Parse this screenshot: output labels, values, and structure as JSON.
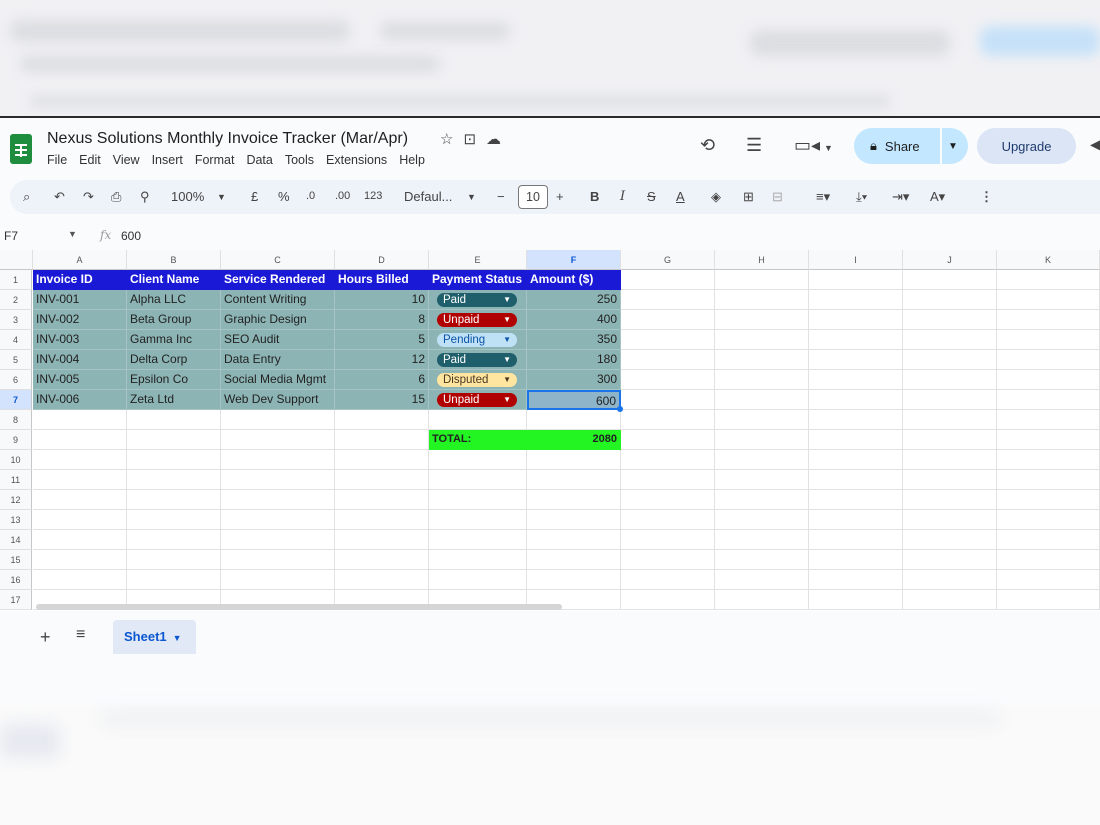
{
  "doc": {
    "title": "Nexus Solutions Monthly Invoice Tracker (Mar/Apr)",
    "menu": [
      "File",
      "Edit",
      "View",
      "Insert",
      "Format",
      "Data",
      "Tools",
      "Extensions",
      "Help"
    ]
  },
  "header": {
    "share_label": "Share",
    "upgrade_label": "Upgrade"
  },
  "toolbar": {
    "zoom": "100%",
    "currency": "£",
    "percent": "%",
    "dec_less": ".0",
    "dec_more": ".00",
    "number_format": "123",
    "font": "Defaul...",
    "font_size": "10",
    "minus": "−",
    "plus": "+",
    "bold": "B",
    "italic": "I"
  },
  "formula_bar": {
    "name_box": "F7",
    "fx": "fx",
    "value": "600"
  },
  "columns": [
    "A",
    "B",
    "C",
    "D",
    "E",
    "F",
    "G",
    "H",
    "I",
    "J",
    "K"
  ],
  "rows": [
    "1",
    "2",
    "3",
    "4",
    "5",
    "6",
    "7",
    "8",
    "9",
    "10",
    "11",
    "12",
    "13",
    "14",
    "15",
    "16",
    "17"
  ],
  "table": {
    "headers": [
      "Invoice ID",
      "Client Name",
      "Service Rendered",
      "Hours Billed",
      "Payment Status",
      "Amount ($)"
    ],
    "rows": [
      {
        "id": "INV-001",
        "client": "Alpha LLC",
        "service": "Content Writing",
        "hours": "10",
        "status": "Paid",
        "amount": "250"
      },
      {
        "id": "INV-002",
        "client": "Beta Group",
        "service": "Graphic Design",
        "hours": "8",
        "status": "Unpaid",
        "amount": "400"
      },
      {
        "id": "INV-003",
        "client": "Gamma Inc",
        "service": "SEO Audit",
        "hours": "5",
        "status": "Pending",
        "amount": "350"
      },
      {
        "id": "INV-004",
        "client": "Delta Corp",
        "service": "Data Entry",
        "hours": "12",
        "status": "Paid",
        "amount": "180"
      },
      {
        "id": "INV-005",
        "client": "Epsilon Co",
        "service": "Social Media Mgmt",
        "hours": "6",
        "status": "Disputed",
        "amount": "300"
      },
      {
        "id": "INV-006",
        "client": "Zeta Ltd",
        "service": "Web Dev Support",
        "hours": "15",
        "status": "Unpaid",
        "amount": "600"
      }
    ],
    "total_label": "TOTAL:",
    "total_value": "2080"
  },
  "status_colors": {
    "Paid": {
      "bg": "#1f5f6b",
      "fg": "#ffffff"
    },
    "Unpaid": {
      "bg": "#b10202",
      "fg": "#ffffff"
    },
    "Pending": {
      "bg": "#bfe1f6",
      "fg": "#0a53a8"
    },
    "Disputed": {
      "bg": "#ffe5a0",
      "fg": "#473821"
    }
  },
  "sheet_tab": {
    "label": "Sheet1"
  }
}
